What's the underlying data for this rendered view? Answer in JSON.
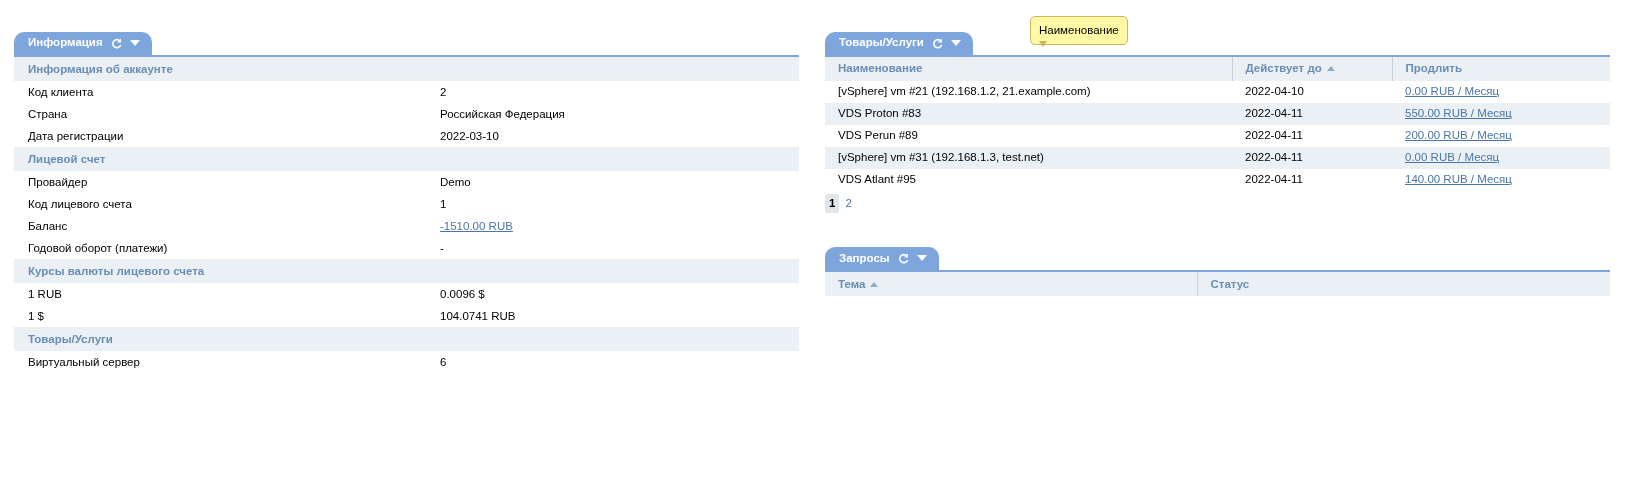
{
  "info_panel": {
    "tab": {
      "label": "Информация"
    },
    "sections": [
      {
        "title": "Информация об аккаунте",
        "rows": [
          {
            "label": "Код клиента",
            "value": "2",
            "kind": "text"
          },
          {
            "label": "Страна",
            "value": "Российская Федерация",
            "kind": "text"
          },
          {
            "label": "Дата регистрации",
            "value": "2022-03-10",
            "kind": "text"
          }
        ]
      },
      {
        "title": "Лицевой счет",
        "rows": [
          {
            "label": "Провайдер",
            "value": "Demo",
            "kind": "text"
          },
          {
            "label": "Код лицевого счета",
            "value": "1",
            "kind": "text"
          },
          {
            "label": "Баланс",
            "value": "-1510.00 RUB",
            "kind": "link"
          },
          {
            "label": "Годовой оборот (платежи)",
            "value": "-",
            "kind": "text"
          }
        ]
      },
      {
        "title": "Курсы валюты лицевого счета",
        "rows": [
          {
            "label": "1 RUB",
            "value": "0.0096 $",
            "kind": "text"
          },
          {
            "label": "1 $",
            "value": "104.0741 RUB",
            "kind": "text"
          }
        ]
      },
      {
        "title": "Товары/Услуги",
        "rows": [
          {
            "label": "Виртуальный сервер",
            "value": "6",
            "kind": "text"
          }
        ]
      }
    ]
  },
  "services_panel": {
    "tab": {
      "label": "Товары/Услуги"
    },
    "tooltip": "Наименование",
    "columns": [
      {
        "label": "Наименование",
        "sorted": false
      },
      {
        "label": "Действует до",
        "sorted": true
      },
      {
        "label": "Продлить",
        "sorted": false
      }
    ],
    "rows": [
      {
        "name": "[vSphere] vm #21 (192.168.1.2, 21.example.com)",
        "until": "2022-04-10",
        "renew": "0.00 RUB / Месяц"
      },
      {
        "name": "VDS Proton #83",
        "until": "2022-04-11",
        "renew": "550.00 RUB / Месяц"
      },
      {
        "name": "VDS Perun #89",
        "until": "2022-04-11",
        "renew": "200.00 RUB / Месяц"
      },
      {
        "name": "[vSphere] vm #31 (192.168.1.3, test.net)",
        "until": "2022-04-11",
        "renew": "0.00 RUB / Месяц"
      },
      {
        "name": "VDS Atlant #95",
        "until": "2022-04-11",
        "renew": "140.00 RUB / Месяц"
      }
    ],
    "pages": [
      {
        "label": "1",
        "selected": true
      },
      {
        "label": "2",
        "selected": false
      }
    ]
  },
  "requests_panel": {
    "tab": {
      "label": "Запросы"
    },
    "columns": [
      {
        "label": "Тема",
        "sorted": true
      },
      {
        "label": "Статус",
        "sorted": false
      }
    ]
  }
}
